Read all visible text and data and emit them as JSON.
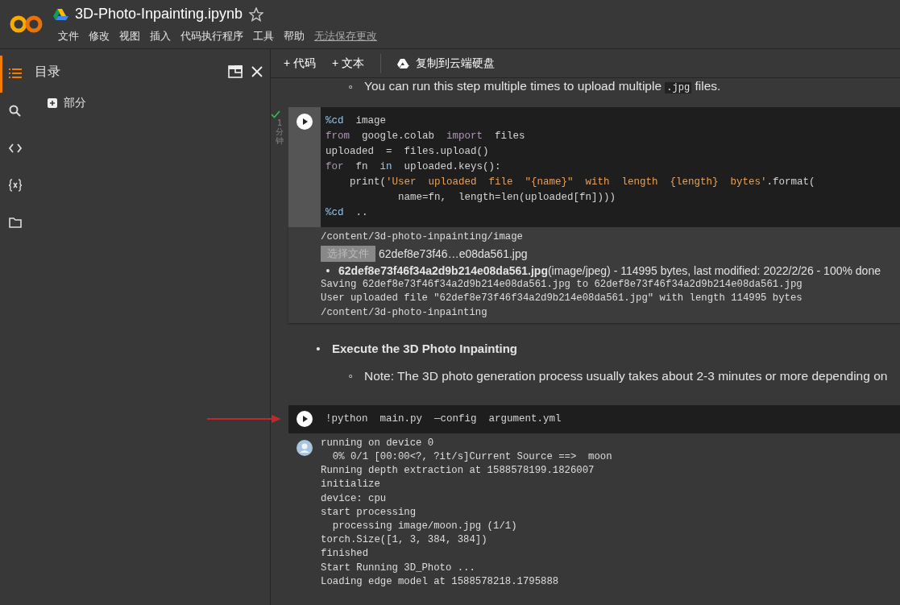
{
  "app": {
    "title": "3D-Photo-Inpainting.ipynb",
    "starred": false,
    "menu": [
      "文件",
      "修改",
      "视图",
      "插入",
      "代码执行程序",
      "工具",
      "帮助"
    ],
    "save_status": "无法保存更改"
  },
  "sidebar": {
    "rail": [
      {
        "selected": true
      },
      {
        "selected": false
      },
      {
        "selected": false
      },
      {
        "selected": false
      },
      {
        "selected": false
      }
    ],
    "panel": {
      "title": "目录",
      "items": [
        {
          "label": "部分"
        }
      ]
    }
  },
  "toolbar": {
    "buttons": [
      "+ 代码",
      "+ 文本"
    ],
    "copy_button": "复制到云端硬盘"
  },
  "cells": [
    {
      "kind": "text",
      "items": [
        {
          "bullet": "◦",
          "bold": false,
          "text": "You can run this step multiple times to upload multiple ",
          "code": ".jpg",
          "text_after": " files."
        }
      ]
    },
    {
      "kind": "code",
      "executed": true,
      "duration": "1 分钟",
      "lines": [
        [
          {
            "kind": "magic",
            "text": "%cd"
          },
          {
            "kind": "plain",
            "text": "  image"
          }
        ],
        [
          {
            "kind": "keyword",
            "text": "from"
          },
          {
            "kind": "plain",
            "text": "  google.colab  "
          },
          {
            "kind": "keyword",
            "text": "import"
          },
          {
            "kind": "plain",
            "text": "  files"
          }
        ],
        [
          {
            "kind": "plain",
            "text": "uploaded  =  files.upload()"
          }
        ],
        [
          {
            "kind": "keyword",
            "text": "for"
          },
          {
            "kind": "plain",
            "text": "  fn  "
          },
          {
            "kind": "magic",
            "text": "in"
          },
          {
            "kind": "plain",
            "text": "  uploaded.keys():"
          }
        ],
        [
          {
            "kind": "plain",
            "text": "    print("
          },
          {
            "kind": "string",
            "text": "'User  uploaded  file  ″{name}″  with  length  {length}  bytes'"
          },
          {
            "kind": "plain",
            "text": ".format("
          }
        ],
        [
          {
            "kind": "plain",
            "text": "            name=fn,  length=len(uploaded[fn])))"
          }
        ],
        [
          {
            "kind": "magic",
            "text": "%cd"
          },
          {
            "kind": "plain",
            "text": "  .."
          }
        ]
      ],
      "output": {
        "avatar": false,
        "lines": [
          {
            "kind": "text",
            "text": "/content/3d-photo-inpainting/image"
          },
          {
            "kind": "file",
            "button": "选择文件",
            "filename": "62def8e73f46…e08da561.jpg"
          },
          {
            "kind": "bullet",
            "bullet": "•",
            "bold": "62def8e73f46f34a2d9b214e08da561.jpg",
            "rest": "(image/jpeg) - 114995 bytes, last modified: 2022/2/26 - 100% done"
          },
          {
            "kind": "text",
            "text": "Saving 62def8e73f46f34a2d9b214e08da561.jpg to 62def8e73f46f34a2d9b214e08da561.jpg"
          },
          {
            "kind": "text",
            "text": "User uploaded file ″62def8e73f46f34a2d9b214e08da561.jpg″ with length 114995 bytes"
          },
          {
            "kind": "text",
            "text": "/content/3d-photo-inpainting"
          }
        ]
      }
    },
    {
      "kind": "text",
      "items": [
        {
          "bullet": "•",
          "bold": true,
          "text": "Execute the 3D Photo Inpainting",
          "children": [
            {
              "bullet": "◦",
              "bold": false,
              "text": "Note: The 3D photo generation process usually takes about 2-3 minutes or more depending on"
            }
          ]
        }
      ]
    },
    {
      "kind": "code",
      "executed": false,
      "lines": [
        [
          {
            "kind": "plain",
            "text": "!python  main.py  —config  argument.yml"
          }
        ]
      ],
      "output": {
        "avatar": true,
        "lines": [
          {
            "kind": "text",
            "text": "running on device 0"
          },
          {
            "kind": "text",
            "text": "  0% 0/1 [00:00<?, ?it/s]Current Source ==>  moon"
          },
          {
            "kind": "text",
            "text": "Running depth extraction at 1588578199.1826007"
          },
          {
            "kind": "text",
            "text": "initialize"
          },
          {
            "kind": "text",
            "text": "device: cpu"
          },
          {
            "kind": "text",
            "text": "start processing"
          },
          {
            "kind": "text",
            "text": "  processing image/moon.jpg (1/1)"
          },
          {
            "kind": "text",
            "text": "torch.Size([1, 3, 384, 384])"
          },
          {
            "kind": "text",
            "text": "finished"
          },
          {
            "kind": "text",
            "text": "Start Running 3D_Photo ..."
          },
          {
            "kind": "text",
            "text": "Loading edge model at 1588578218.1795888"
          }
        ]
      }
    }
  ]
}
